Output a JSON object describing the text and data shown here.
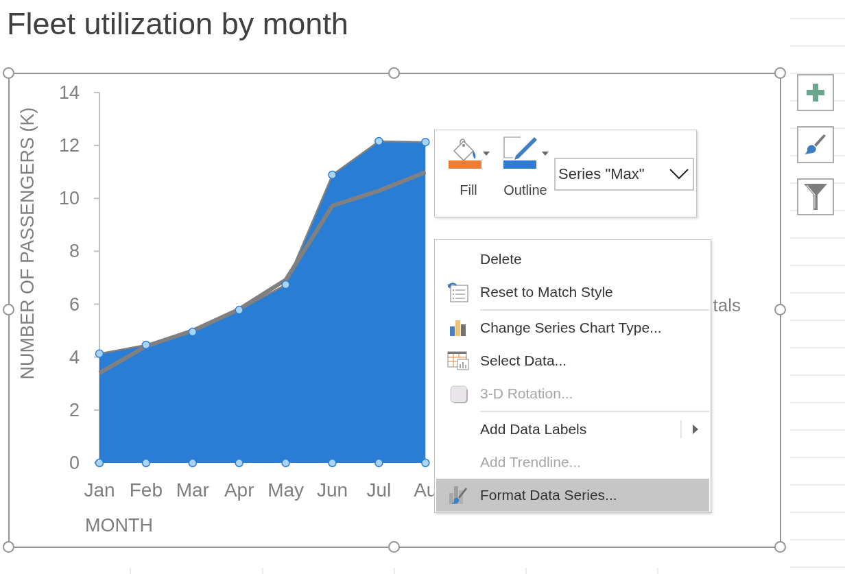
{
  "title": "Fleet utilization by month",
  "chart": {
    "selected": true,
    "chart_data": {
      "type": "area",
      "xlabel": "MONTH",
      "ylabel": "NUMBER OF PASSENGERS (K)",
      "categories": [
        "Jan",
        "Feb",
        "Mar",
        "Apr",
        "May",
        "Jun",
        "Jul",
        "Au"
      ],
      "series": [
        {
          "type": "area",
          "color": "#2a7dd4",
          "values": [
            4.13,
            4.46,
            4.95,
            5.78,
            6.74,
            10.89,
            12.16,
            12.13
          ]
        },
        {
          "type": "scatter",
          "color": "#a9d4f5",
          "values": [
            0,
            0,
            0,
            0,
            0,
            0,
            0,
            0
          ]
        },
        {
          "name": "tals",
          "type": "line",
          "color": "#808080",
          "values": [
            3.4,
            4.41,
            5.0,
            5.81,
            6.92,
            9.72,
            10.29,
            10.99
          ]
        }
      ],
      "ylim": [
        0,
        14
      ],
      "yticks": [
        0,
        2,
        4,
        6,
        8,
        10,
        12,
        14
      ]
    }
  },
  "mini_toolbar": {
    "tools": [
      {
        "label": "Fill",
        "color": "#ed7d31"
      },
      {
        "label": "Outline",
        "color": "#2e7bd6"
      }
    ],
    "series_picker": {
      "value": "Series \"Max\""
    }
  },
  "context_menu": {
    "items": [
      {
        "kind": "action",
        "label": "Delete",
        "disabled": false,
        "selected": false,
        "submenu": false
      },
      {
        "kind": "action",
        "label": "Reset to Match Style",
        "disabled": false,
        "selected": false,
        "submenu": false
      },
      {
        "kind": "separator"
      },
      {
        "kind": "action",
        "label": "Change Series Chart Type...",
        "disabled": false,
        "selected": false,
        "submenu": false
      },
      {
        "kind": "action",
        "label": "Select Data...",
        "disabled": false,
        "selected": false,
        "submenu": false
      },
      {
        "kind": "action",
        "label": "3-D Rotation...",
        "disabled": true,
        "selected": false,
        "submenu": false
      },
      {
        "kind": "separator"
      },
      {
        "kind": "action",
        "label": "Add Data Labels",
        "disabled": false,
        "selected": false,
        "submenu": true
      },
      {
        "kind": "action",
        "label": "Add Trendline...",
        "disabled": true,
        "selected": false,
        "submenu": false
      },
      {
        "kind": "action",
        "label": "Format Data Series...",
        "disabled": false,
        "selected": true,
        "submenu": false
      }
    ]
  }
}
